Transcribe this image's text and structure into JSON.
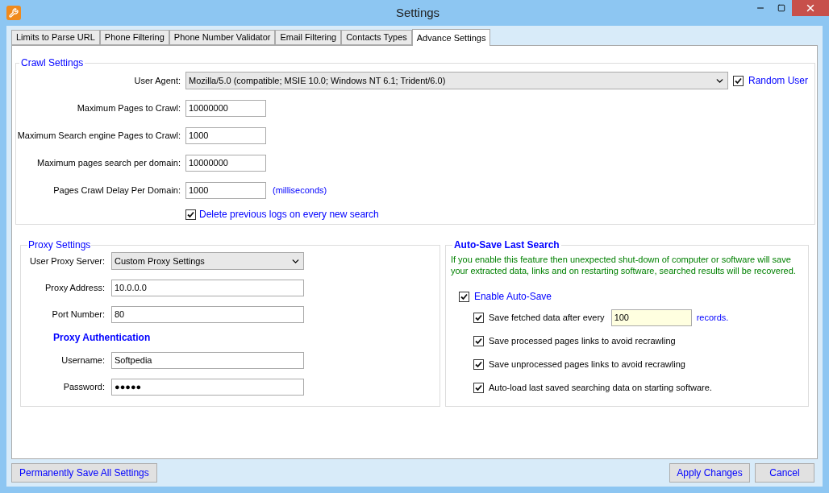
{
  "window": {
    "title": "Settings"
  },
  "tabs": [
    {
      "label": "Limits to Parse URL",
      "selected": false
    },
    {
      "label": "Phone Filtering",
      "selected": false
    },
    {
      "label": "Phone Number Validator",
      "selected": false
    },
    {
      "label": "Email Filtering",
      "selected": false
    },
    {
      "label": "Contacts Types",
      "selected": false
    },
    {
      "label": "Advance Settings",
      "selected": true
    }
  ],
  "crawl_settings": {
    "title": "Crawl Settings",
    "user_agent": {
      "label": "User Agent:",
      "value": "Mozilla/5.0 (compatible; MSIE 10.0; Windows NT 6.1; Trident/6.0)"
    },
    "random_user": {
      "label": "Random User",
      "checked": true
    },
    "fields": [
      {
        "label": "Maximum Pages to Crawl:",
        "value": "10000000"
      },
      {
        "label": "Maximum Search engine Pages to Crawl:",
        "value": "1000"
      },
      {
        "label": "Maximum pages search per domain:",
        "value": "10000000"
      },
      {
        "label": "Pages Crawl Delay Per Domain:",
        "value": "1000",
        "unit": "(milliseconds)"
      }
    ],
    "delete_logs": {
      "label": "Delete previous logs on every new search",
      "checked": true
    }
  },
  "proxy_settings": {
    "title": "Proxy Settings",
    "server": {
      "label": "User Proxy Server:",
      "value": "Custom Proxy Settings"
    },
    "fields": [
      {
        "label": "Proxy Address:",
        "value": "10.0.0.0"
      },
      {
        "label": "Port Number:",
        "value": "80"
      }
    ],
    "auth_title": "Proxy Authentication",
    "auth_fields": [
      {
        "label": "Username:",
        "value": "Softpedia"
      },
      {
        "label": "Password:",
        "value": "●●●●●"
      }
    ]
  },
  "auto_save": {
    "title": "Auto-Save Last Search",
    "description": "If you enable this feature then unexpected shut-down of computer or software will save your extracted data, links and on restarting software, searched results will be recovered.",
    "enable": {
      "label": "Enable Auto-Save",
      "checked": true
    },
    "options": [
      {
        "kind": "input",
        "label": "Save fetched data after every",
        "checked": true,
        "value": "100",
        "suffix": "records."
      },
      {
        "kind": "plain",
        "label": "Save processed pages links to avoid recrawling",
        "checked": true
      },
      {
        "kind": "plain",
        "label": "Save unprocessed pages links to avoid recrawling",
        "checked": true
      },
      {
        "kind": "plain",
        "label": "Auto-load last saved searching data on starting software.",
        "checked": true
      }
    ]
  },
  "buttons": {
    "save_all": "Permanently Save All Settings",
    "apply": "Apply Changes",
    "cancel": "Cancel"
  }
}
